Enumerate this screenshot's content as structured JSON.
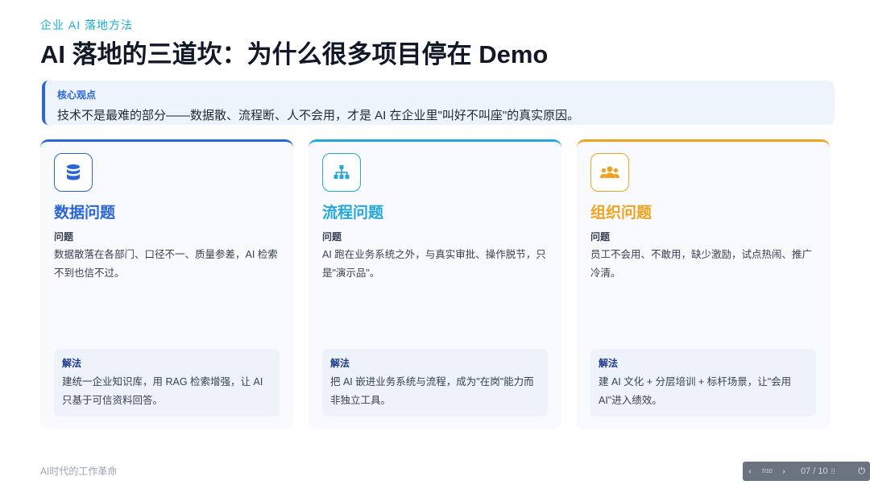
{
  "header": {
    "kicker": "企业 AI 落地方法",
    "title": "AI 落地的三道坎：为什么很多项目停在 Demo"
  },
  "insight": {
    "label": "核心观点",
    "text": "技术不是最难的部分——数据散、流程断、人不会用，才是 AI 在企业里\"叫好不叫座\"的真实原因。"
  },
  "cards": [
    {
      "icon": "database-icon",
      "title": "数据问题",
      "problem_label": "问题",
      "problem_text": "数据散落在各部门、口径不一、质量参差，AI 检索不到也信不过。",
      "solution_label": "解法",
      "solution_text": "建统一企业知识库，用 RAG 检索增强，让 AI 只基于可信资料回答。"
    },
    {
      "icon": "sitemap-icon",
      "title": "流程问题",
      "problem_label": "问题",
      "problem_text": "AI 跑在业务系统之外，与真实审批、操作脱节，只是\"演示品\"。",
      "solution_label": "解法",
      "solution_text": "把 AI 嵌进业务系统与流程，成为\"在岗\"能力而非独立工具。"
    },
    {
      "icon": "users-icon",
      "title": "组织问题",
      "problem_label": "问题",
      "problem_text": "员工不会用、不敢用，缺少激励，试点热闹、推广冷清。",
      "solution_label": "解法",
      "solution_text": "建 AI 文化 + 分层培训 + 标杆场景，让\"会用AI\"进入绩效。"
    }
  ],
  "footer": {
    "text": "AI时代的工作革命"
  },
  "navbar": {
    "prev": "‹",
    "page": "7/10",
    "next": "›",
    "count": "07 / 10",
    "grid": "⁞⁞",
    "power": "⏻"
  },
  "colors": {
    "data": "#2b66d6",
    "process": "#23a8d9",
    "org": "#efa31f",
    "kicker": "#19b0cf"
  }
}
